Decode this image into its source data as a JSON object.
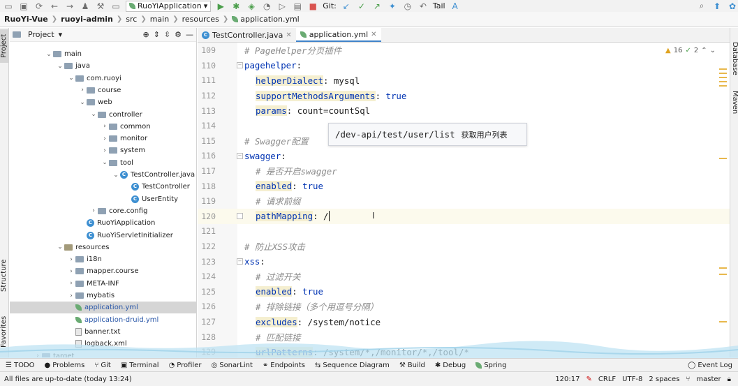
{
  "toolbar": {
    "run_config": "RuoYiApplication",
    "git_label": "Git:",
    "tail_label": "Tail"
  },
  "breadcrumb": [
    "RuoYi-Vue",
    "ruoyi-admin",
    "src",
    "main",
    "resources",
    "application.yml"
  ],
  "left_strip": {
    "project": "Project",
    "structure": "Structure",
    "favorites": "Favorites"
  },
  "right_strip": {
    "database": "Database",
    "maven": "Maven"
  },
  "project_panel": {
    "title": "Project",
    "tree": [
      {
        "label": "main",
        "icon": "folder-icon"
      },
      {
        "label": "java",
        "icon": "folder-icon"
      },
      {
        "label": "com.ruoyi",
        "icon": "package-icon"
      },
      {
        "label": "course",
        "icon": "package-icon"
      },
      {
        "label": "web",
        "icon": "package-icon"
      },
      {
        "label": "controller",
        "icon": "package-icon"
      },
      {
        "label": "common",
        "icon": "package-icon"
      },
      {
        "label": "monitor",
        "icon": "package-icon"
      },
      {
        "label": "system",
        "icon": "package-icon"
      },
      {
        "label": "tool",
        "icon": "package-icon"
      },
      {
        "label": "TestController.java",
        "icon": "class-icon"
      },
      {
        "label": "TestController",
        "icon": "class-icon"
      },
      {
        "label": "UserEntity",
        "icon": "class-icon"
      },
      {
        "label": "core.config",
        "icon": "package-icon"
      },
      {
        "label": "RuoYiApplication",
        "icon": "class-icon"
      },
      {
        "label": "RuoYiServletInitializer",
        "icon": "class-icon"
      },
      {
        "label": "resources",
        "icon": "resources-folder-icon"
      },
      {
        "label": "i18n",
        "icon": "folder-icon"
      },
      {
        "label": "mapper.course",
        "icon": "folder-icon"
      },
      {
        "label": "META-INF",
        "icon": "folder-icon"
      },
      {
        "label": "mybatis",
        "icon": "folder-icon"
      },
      {
        "label": "application.yml",
        "icon": "yaml-icon"
      },
      {
        "label": "application-druid.yml",
        "icon": "yaml-icon"
      },
      {
        "label": "banner.txt",
        "icon": "text-file-icon"
      },
      {
        "label": "logback.xml",
        "icon": "xml-file-icon"
      },
      {
        "label": "target",
        "icon": "folder-icon"
      }
    ]
  },
  "tabs": [
    {
      "label": "TestController.java",
      "active": false
    },
    {
      "label": "application.yml",
      "active": true
    }
  ],
  "inspections": {
    "warnings": "16",
    "weak": "2"
  },
  "editor": {
    "lines": [
      {
        "num": "109",
        "comment": "# PageHelper分页插件"
      },
      {
        "num": "110",
        "key": "pagehelper",
        "punct": ":"
      },
      {
        "num": "111",
        "key": "helperDialect",
        "punct": ": ",
        "value": "mysql"
      },
      {
        "num": "112",
        "key": "supportMethodsArguments",
        "punct": ": ",
        "value": "true"
      },
      {
        "num": "113",
        "key": "params",
        "punct": ": ",
        "value": "count=countSql"
      },
      {
        "num": "114"
      },
      {
        "num": "115",
        "comment": "# Swagger配置"
      },
      {
        "num": "116",
        "key": "swagger",
        "punct": ":"
      },
      {
        "num": "117",
        "comment": "# 是否开启swagger"
      },
      {
        "num": "118",
        "key": "enabled",
        "punct": ": ",
        "value": "true"
      },
      {
        "num": "119",
        "comment": "# 请求前缀"
      },
      {
        "num": "120",
        "key": "pathMapping",
        "punct": ": ",
        "value": "/"
      },
      {
        "num": "121"
      },
      {
        "num": "122",
        "comment": "# 防止XSS攻击"
      },
      {
        "num": "123",
        "key": "xss",
        "punct": ":"
      },
      {
        "num": "124",
        "comment": "# 过滤开关"
      },
      {
        "num": "125",
        "key": "enabled",
        "punct": ": ",
        "value": "true"
      },
      {
        "num": "126",
        "comment": "# 排除链接（多个用逗号分隔）"
      },
      {
        "num": "127",
        "key": "excludes",
        "punct": ": ",
        "value": "/system/notice"
      },
      {
        "num": "128",
        "comment": "# 匹配链接"
      },
      {
        "num": "129",
        "key": "urlPatterns",
        "punct": ": ",
        "value": "/system/*,/monitor/*,/tool/*"
      }
    ]
  },
  "tooltip": {
    "path": "/dev-api/test/user/list",
    "desc": "获取用户列表"
  },
  "bottom_tools": [
    "TODO",
    "Problems",
    "Git",
    "Terminal",
    "Profiler",
    "SonarLint",
    "Endpoints",
    "Sequence Diagram",
    "Build",
    "Debug",
    "Spring",
    "Event Log"
  ],
  "status": {
    "message": "All files are up-to-date (today 13:24)",
    "position": "120:17",
    "line_sep": "CRLF",
    "encoding": "UTF-8",
    "indent": "2 spaces",
    "branch": "master"
  }
}
